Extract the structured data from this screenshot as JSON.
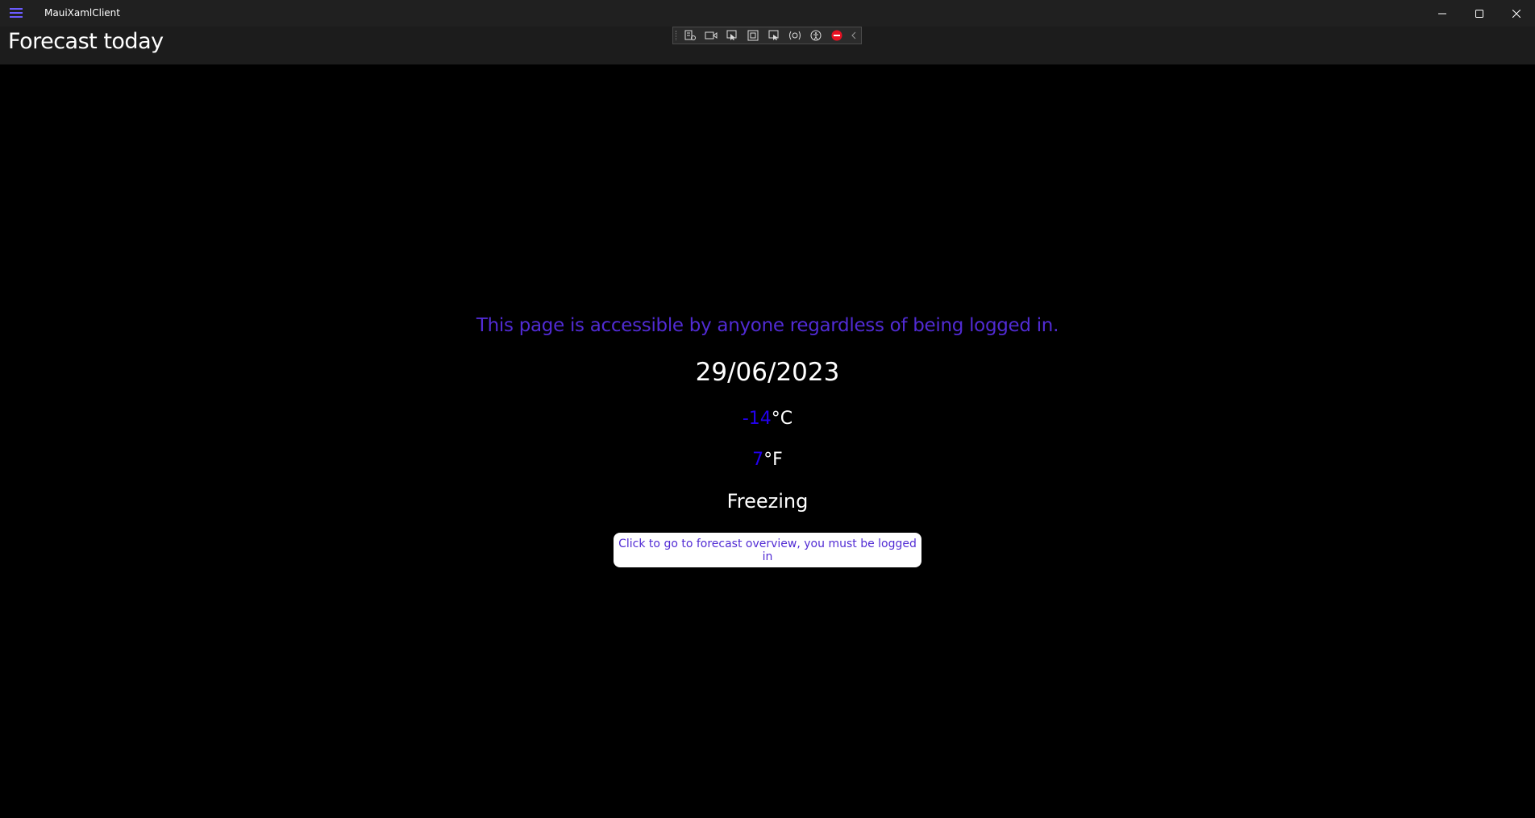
{
  "window": {
    "title": "MauiXamlClient",
    "controls": {
      "minimize_icon": "minimize-icon",
      "maximize_icon": "maximize-icon",
      "close_icon": "close-icon"
    }
  },
  "header": {
    "page_title": "Forecast today"
  },
  "debug_toolbar": {
    "icons": [
      "live-visual-tree-icon",
      "record-icon",
      "select-element-icon",
      "display-adorners-icon",
      "track-focus-icon",
      "binding-failures-icon",
      "accessibility-icon",
      "disable-icon",
      "collapse-chevron-icon"
    ]
  },
  "main": {
    "notice": "This page is accessible by anyone regardless of being logged in.",
    "date": "29/06/2023",
    "temperature_c": {
      "value": "-14",
      "unit": "°C"
    },
    "temperature_f": {
      "value": "7",
      "unit": "°F"
    },
    "summary": "Freezing",
    "button_label": "Click to go to forecast overview, you must be logged in"
  },
  "colors": {
    "accent": "#512bd4",
    "temperature_value": "#2200ee",
    "background": "#000000",
    "titlebar": "#202020",
    "navbar": "#1c1c1c"
  }
}
